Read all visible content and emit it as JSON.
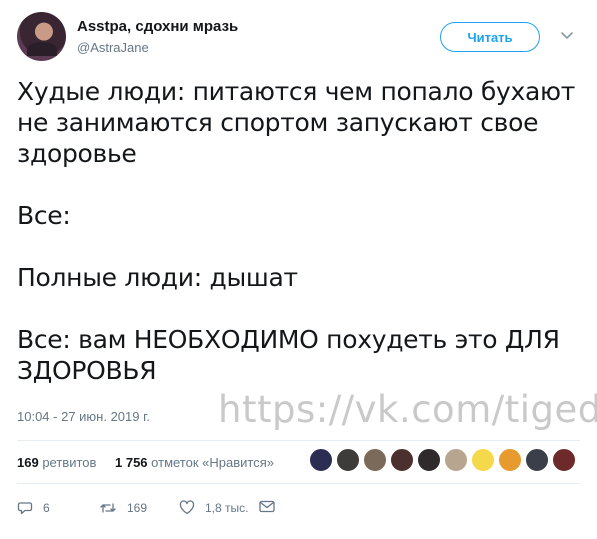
{
  "author": {
    "display_name": "Asstpa, сдохни мразь",
    "handle": "@AstraJane"
  },
  "header": {
    "follow_label": "Читать",
    "more_icon": "chevron-down-icon"
  },
  "tweet": {
    "text": "Худые люди: питаются чем попало бухают\nне занимаются спортом запускают свое\nздоровье\n\nВсе:\n\nПолные люди: дышат\n\nВсе: вам НЕОБХОДИМО похудеть это ДЛЯ\nЗДОРОВЬЯ",
    "timestamp": "10:04 - 27 июн. 2019 г.",
    "watermark": "https://vk.com/tigede"
  },
  "stats": {
    "retweets_count": "169",
    "retweets_label": "ретвитов",
    "likes_count": "1 756",
    "likes_label": "отметок «Нравится»"
  },
  "likers": [
    {
      "name": "liker-1",
      "color": "#2b2d52"
    },
    {
      "name": "liker-2",
      "color": "#3d3c3a"
    },
    {
      "name": "liker-3",
      "color": "#7b6a5a"
    },
    {
      "name": "liker-4",
      "color": "#4a3130"
    },
    {
      "name": "liker-5",
      "color": "#2f2a2c"
    },
    {
      "name": "liker-6",
      "color": "#b8a58f"
    },
    {
      "name": "liker-7",
      "color": "#f5d94a"
    },
    {
      "name": "liker-8",
      "color": "#e79a2d"
    },
    {
      "name": "liker-9",
      "color": "#3b3f4a"
    },
    {
      "name": "liker-10",
      "color": "#6e2a2a"
    }
  ],
  "actions": {
    "replies_count": "6",
    "retweets_count": "169",
    "likes_count": "1,8 тыс."
  },
  "colors": {
    "accent": "#1da1f2",
    "muted": "#657786",
    "text": "#14171a",
    "divider": "#e6ecf0"
  }
}
